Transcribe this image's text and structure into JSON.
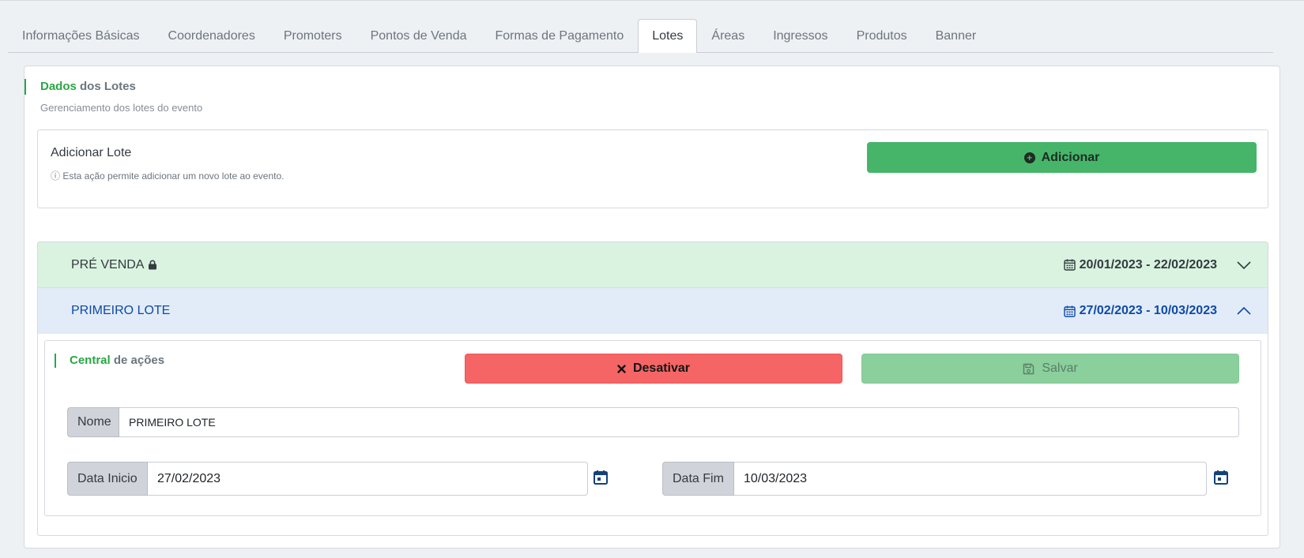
{
  "tabs": [
    {
      "label": "Informações Básicas",
      "active": false
    },
    {
      "label": "Coordenadores",
      "active": false
    },
    {
      "label": "Promoters",
      "active": false
    },
    {
      "label": "Pontos de Venda",
      "active": false
    },
    {
      "label": "Formas de Pagamento",
      "active": false
    },
    {
      "label": "Lotes",
      "active": true
    },
    {
      "label": "Áreas",
      "active": false
    },
    {
      "label": "Ingressos",
      "active": false
    },
    {
      "label": "Produtos",
      "active": false
    },
    {
      "label": "Banner",
      "active": false
    }
  ],
  "section": {
    "title_accent": "Dados",
    "title_rest": " dos Lotes",
    "subtitle": "Gerenciamento dos lotes do evento"
  },
  "add_panel": {
    "title": "Adicionar Lote",
    "hint": "ⓘ Esta ação permite adicionar um novo lote ao evento.",
    "button_label": "Adicionar"
  },
  "lots": [
    {
      "name": "PRÉ VENDA",
      "locked": true,
      "dates": "20/01/2023 - 22/02/2023",
      "expanded": false
    },
    {
      "name": "PRIMEIRO LOTE",
      "locked": false,
      "dates": "27/02/2023 - 10/03/2023",
      "expanded": true
    }
  ],
  "actions": {
    "title_accent": "Central",
    "title_rest": " de ações",
    "deactivate_label": "Desativar",
    "save_label": "Salvar"
  },
  "form": {
    "name_label": "Nome",
    "name_value": "PRIMEIRO LOTE",
    "start_label": "Data Inicio",
    "start_value": "27/02/2023",
    "end_label": "Data Fim",
    "end_value": "10/03/2023"
  },
  "colors": {
    "accent_green": "#28a745",
    "add_button": "#46b56a",
    "deactivate_button": "#f56565",
    "save_button": "#8acf9c",
    "lot_closed_bg": "#d9f3e0",
    "lot_open_bg": "#e2ebf8",
    "lot_open_text": "#0d4aa7"
  }
}
